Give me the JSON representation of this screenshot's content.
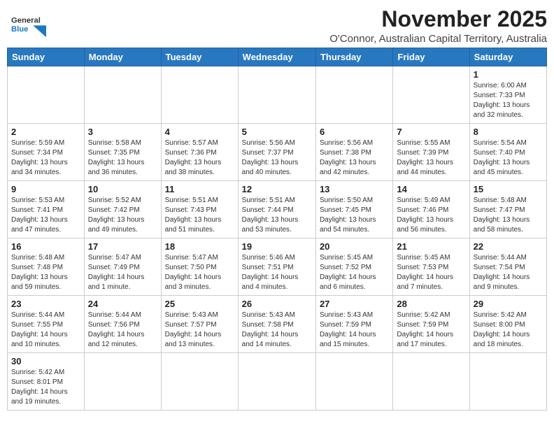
{
  "header": {
    "logo_general": "General",
    "logo_blue": "Blue",
    "month": "November 2025",
    "location": "O'Connor, Australian Capital Territory, Australia"
  },
  "days_of_week": [
    "Sunday",
    "Monday",
    "Tuesday",
    "Wednesday",
    "Thursday",
    "Friday",
    "Saturday"
  ],
  "weeks": [
    [
      {
        "day": "",
        "info": ""
      },
      {
        "day": "",
        "info": ""
      },
      {
        "day": "",
        "info": ""
      },
      {
        "day": "",
        "info": ""
      },
      {
        "day": "",
        "info": ""
      },
      {
        "day": "",
        "info": ""
      },
      {
        "day": "1",
        "info": "Sunrise: 6:00 AM\nSunset: 7:33 PM\nDaylight: 13 hours\nand 32 minutes."
      }
    ],
    [
      {
        "day": "2",
        "info": "Sunrise: 5:59 AM\nSunset: 7:34 PM\nDaylight: 13 hours\nand 34 minutes."
      },
      {
        "day": "3",
        "info": "Sunrise: 5:58 AM\nSunset: 7:35 PM\nDaylight: 13 hours\nand 36 minutes."
      },
      {
        "day": "4",
        "info": "Sunrise: 5:57 AM\nSunset: 7:36 PM\nDaylight: 13 hours\nand 38 minutes."
      },
      {
        "day": "5",
        "info": "Sunrise: 5:56 AM\nSunset: 7:37 PM\nDaylight: 13 hours\nand 40 minutes."
      },
      {
        "day": "6",
        "info": "Sunrise: 5:56 AM\nSunset: 7:38 PM\nDaylight: 13 hours\nand 42 minutes."
      },
      {
        "day": "7",
        "info": "Sunrise: 5:55 AM\nSunset: 7:39 PM\nDaylight: 13 hours\nand 44 minutes."
      },
      {
        "day": "8",
        "info": "Sunrise: 5:54 AM\nSunset: 7:40 PM\nDaylight: 13 hours\nand 45 minutes."
      }
    ],
    [
      {
        "day": "9",
        "info": "Sunrise: 5:53 AM\nSunset: 7:41 PM\nDaylight: 13 hours\nand 47 minutes."
      },
      {
        "day": "10",
        "info": "Sunrise: 5:52 AM\nSunset: 7:42 PM\nDaylight: 13 hours\nand 49 minutes."
      },
      {
        "day": "11",
        "info": "Sunrise: 5:51 AM\nSunset: 7:43 PM\nDaylight: 13 hours\nand 51 minutes."
      },
      {
        "day": "12",
        "info": "Sunrise: 5:51 AM\nSunset: 7:44 PM\nDaylight: 13 hours\nand 53 minutes."
      },
      {
        "day": "13",
        "info": "Sunrise: 5:50 AM\nSunset: 7:45 PM\nDaylight: 13 hours\nand 54 minutes."
      },
      {
        "day": "14",
        "info": "Sunrise: 5:49 AM\nSunset: 7:46 PM\nDaylight: 13 hours\nand 56 minutes."
      },
      {
        "day": "15",
        "info": "Sunrise: 5:48 AM\nSunset: 7:47 PM\nDaylight: 13 hours\nand 58 minutes."
      }
    ],
    [
      {
        "day": "16",
        "info": "Sunrise: 5:48 AM\nSunset: 7:48 PM\nDaylight: 13 hours\nand 59 minutes."
      },
      {
        "day": "17",
        "info": "Sunrise: 5:47 AM\nSunset: 7:49 PM\nDaylight: 14 hours\nand 1 minute."
      },
      {
        "day": "18",
        "info": "Sunrise: 5:47 AM\nSunset: 7:50 PM\nDaylight: 14 hours\nand 3 minutes."
      },
      {
        "day": "19",
        "info": "Sunrise: 5:46 AM\nSunset: 7:51 PM\nDaylight: 14 hours\nand 4 minutes."
      },
      {
        "day": "20",
        "info": "Sunrise: 5:45 AM\nSunset: 7:52 PM\nDaylight: 14 hours\nand 6 minutes."
      },
      {
        "day": "21",
        "info": "Sunrise: 5:45 AM\nSunset: 7:53 PM\nDaylight: 14 hours\nand 7 minutes."
      },
      {
        "day": "22",
        "info": "Sunrise: 5:44 AM\nSunset: 7:54 PM\nDaylight: 14 hours\nand 9 minutes."
      }
    ],
    [
      {
        "day": "23",
        "info": "Sunrise: 5:44 AM\nSunset: 7:55 PM\nDaylight: 14 hours\nand 10 minutes."
      },
      {
        "day": "24",
        "info": "Sunrise: 5:44 AM\nSunset: 7:56 PM\nDaylight: 14 hours\nand 12 minutes."
      },
      {
        "day": "25",
        "info": "Sunrise: 5:43 AM\nSunset: 7:57 PM\nDaylight: 14 hours\nand 13 minutes."
      },
      {
        "day": "26",
        "info": "Sunrise: 5:43 AM\nSunset: 7:58 PM\nDaylight: 14 hours\nand 14 minutes."
      },
      {
        "day": "27",
        "info": "Sunrise: 5:43 AM\nSunset: 7:59 PM\nDaylight: 14 hours\nand 15 minutes."
      },
      {
        "day": "28",
        "info": "Sunrise: 5:42 AM\nSunset: 7:59 PM\nDaylight: 14 hours\nand 17 minutes."
      },
      {
        "day": "29",
        "info": "Sunrise: 5:42 AM\nSunset: 8:00 PM\nDaylight: 14 hours\nand 18 minutes."
      }
    ],
    [
      {
        "day": "30",
        "info": "Sunrise: 5:42 AM\nSunset: 8:01 PM\nDaylight: 14 hours\nand 19 minutes."
      },
      {
        "day": "",
        "info": ""
      },
      {
        "day": "",
        "info": ""
      },
      {
        "day": "",
        "info": ""
      },
      {
        "day": "",
        "info": ""
      },
      {
        "day": "",
        "info": ""
      },
      {
        "day": "",
        "info": ""
      }
    ]
  ]
}
